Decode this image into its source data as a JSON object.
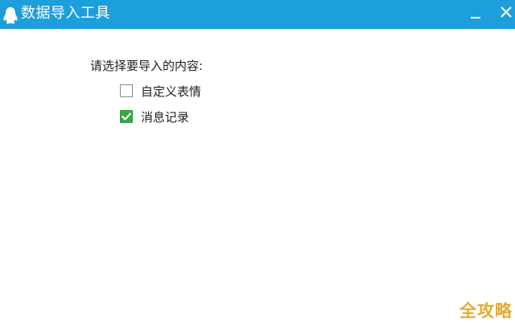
{
  "window": {
    "title": "数据导入工具",
    "title_icon": "qq-penguin-icon",
    "accent_color": "#1d9fdb",
    "controls": {
      "minimize_icon": "minimize-icon",
      "close_icon": "close-icon"
    }
  },
  "main": {
    "prompt": "请选择要导入的内容:",
    "options": [
      {
        "label": "自定义表情",
        "checked": false
      },
      {
        "label": "消息记录",
        "checked": true
      }
    ],
    "check_color": "#35a845"
  },
  "watermark": {
    "text": "全攻略"
  }
}
